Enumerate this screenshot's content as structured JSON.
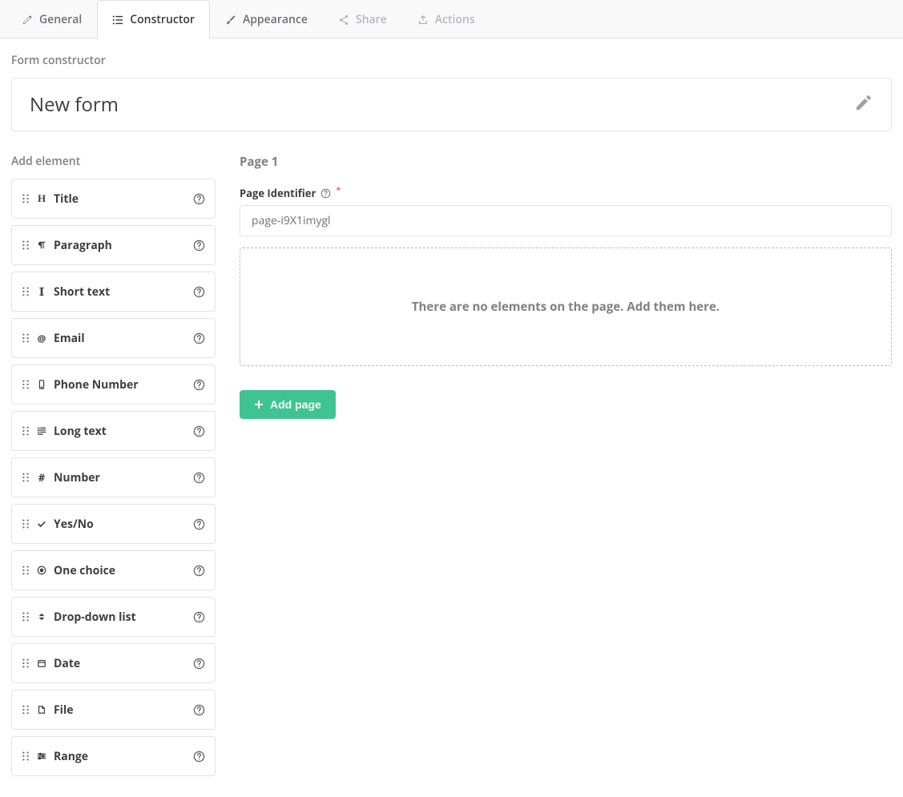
{
  "tabs": [
    {
      "label": "General",
      "icon": "pencil",
      "active": false,
      "disabled": false
    },
    {
      "label": "Constructor",
      "icon": "list",
      "active": true,
      "disabled": false
    },
    {
      "label": "Appearance",
      "icon": "brush",
      "active": false,
      "disabled": false
    },
    {
      "label": "Share",
      "icon": "share",
      "active": false,
      "disabled": true
    },
    {
      "label": "Actions",
      "icon": "export",
      "active": false,
      "disabled": true
    }
  ],
  "section_label": "Form constructor",
  "form_title": "New form",
  "sidebar": {
    "heading": "Add element",
    "elements": [
      {
        "label": "Title",
        "icon": "heading"
      },
      {
        "label": "Paragraph",
        "icon": "paragraph"
      },
      {
        "label": "Short text",
        "icon": "text-cursor"
      },
      {
        "label": "Email",
        "icon": "at"
      },
      {
        "label": "Phone Number",
        "icon": "phone"
      },
      {
        "label": "Long text",
        "icon": "long-text"
      },
      {
        "label": "Number",
        "icon": "hash"
      },
      {
        "label": "Yes/No",
        "icon": "check"
      },
      {
        "label": "One choice",
        "icon": "target"
      },
      {
        "label": "Drop-down list",
        "icon": "sort"
      },
      {
        "label": "Date",
        "icon": "calendar"
      },
      {
        "label": "File",
        "icon": "file"
      },
      {
        "label": "Range",
        "icon": "sliders"
      }
    ]
  },
  "page": {
    "title": "Page 1",
    "identifier_label": "Page Identifier",
    "identifier_value": "page-i9X1imygl",
    "dropzone_message": "There are no elements on the page. Add them here.",
    "add_page_label": "Add page"
  }
}
